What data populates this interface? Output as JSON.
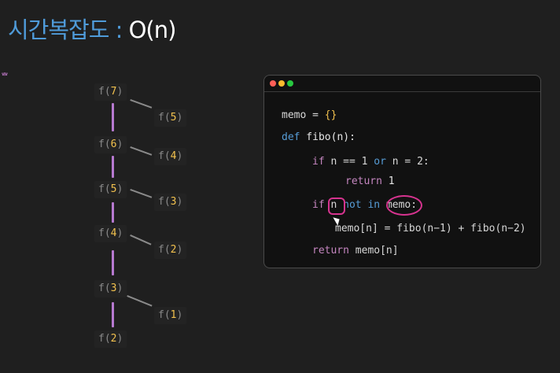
{
  "title": {
    "korean": "시간복잡도 : ",
    "complexity": "O(n)"
  },
  "left_mark": "ᇂ",
  "tree": {
    "main_nodes": [
      {
        "label": "f(",
        "n": "7",
        "close": ")"
      },
      {
        "label": "f(",
        "n": "6",
        "close": ")"
      },
      {
        "label": "f(",
        "n": "5",
        "close": ")"
      },
      {
        "label": "f(",
        "n": "4",
        "close": ")"
      },
      {
        "label": "f(",
        "n": "3",
        "close": ")"
      },
      {
        "label": "f(",
        "n": "2",
        "close": ")"
      }
    ],
    "side_nodes": [
      {
        "label": "f(",
        "n": "5",
        "close": ")"
      },
      {
        "label": "f(",
        "n": "4",
        "close": ")"
      },
      {
        "label": "f(",
        "n": "3",
        "close": ")"
      },
      {
        "label": "f(",
        "n": "2",
        "close": ")"
      },
      {
        "label": "f(",
        "n": "1",
        "close": ")"
      }
    ]
  },
  "code": {
    "l1": {
      "a": "memo = ",
      "b": "{}"
    },
    "l2": {
      "def": "def",
      "rest": " fibo(n):"
    },
    "l3": {
      "if": "if",
      "a": " n == 1 ",
      "or": "or",
      "b": " n = 2:"
    },
    "l4": {
      "ret": "return",
      "v": " 1"
    },
    "l5": {
      "if": "if",
      "n": " n ",
      "not": "not",
      "in": " in ",
      "memo": "memo",
      "colon": ":"
    },
    "l6": {
      "text": "memo[n] = fibo(n−1) + fibo(n−2)"
    },
    "l7": {
      "ret": "return",
      "v": " memo[n]"
    }
  },
  "colors": {
    "accent_blue": "#4f9bd9",
    "tree_line": "#b779d0",
    "highlight": "#d6338f",
    "number": "#f2c14e"
  }
}
